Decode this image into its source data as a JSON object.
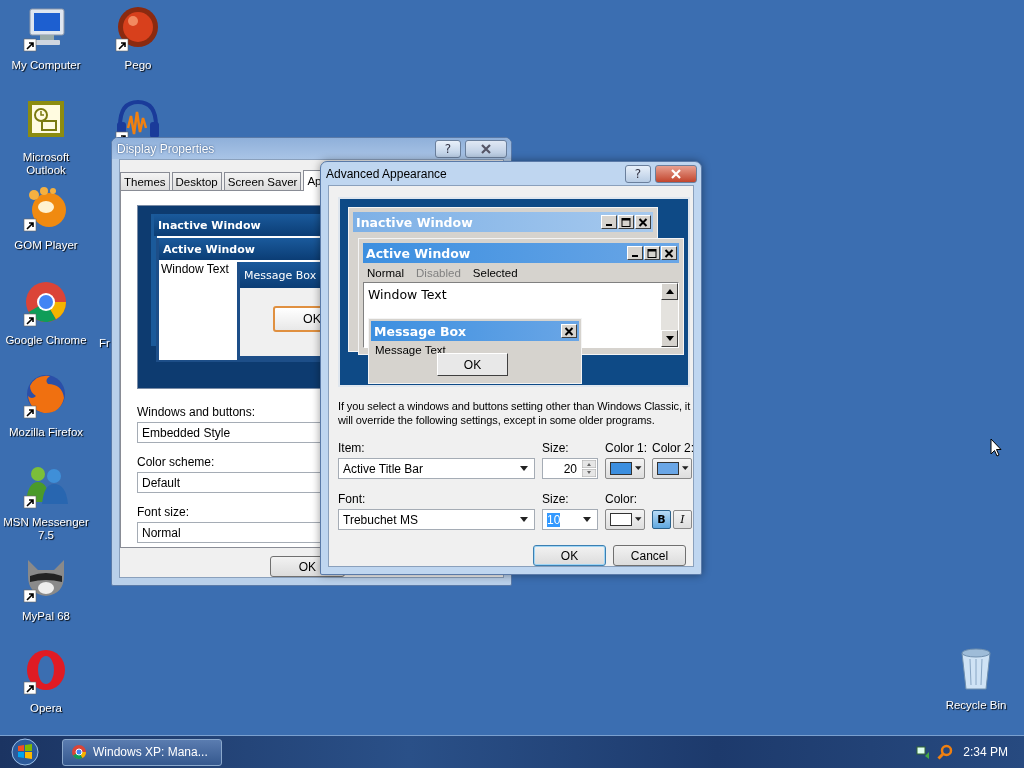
{
  "desktop_icons": [
    {
      "label": "My Computer",
      "kind": "computer"
    },
    {
      "label": "Pego",
      "kind": "ball"
    },
    {
      "label": "Microsoft\nOutlook",
      "kind": "outlook"
    },
    {
      "label": "GOM Player",
      "kind": "bubble"
    },
    {
      "label": "Google Chrome",
      "kind": "segments"
    },
    {
      "label": "Fr",
      "kind": "none"
    },
    {
      "label": "Mozilla Firefox",
      "kind": "globe"
    },
    {
      "label": "MSN Messenger\n7.5",
      "kind": "people"
    },
    {
      "label": "MyPal 68",
      "kind": "raccoon"
    },
    {
      "label": "Opera",
      "kind": "ring"
    },
    {
      "kind": "headphones"
    },
    {
      "label": "Recycle Bin",
      "kind": "bin"
    }
  ],
  "display_properties": {
    "title": "Display Properties",
    "help": "?",
    "tabs": [
      {
        "label": "Themes",
        "selected": false
      },
      {
        "label": "Desktop",
        "selected": false
      },
      {
        "label": "Screen Saver",
        "selected": false
      },
      {
        "label": "Ap",
        "selected": true
      }
    ],
    "preview": {
      "inactive_title": "Inactive Window",
      "active_title": "Active Window",
      "window_text": "Window Text",
      "message_title": "Message Box",
      "ok": "OK"
    },
    "fields": [
      {
        "label": "Windows and buttons:",
        "value": "Embedded Style"
      },
      {
        "label": "Color scheme:",
        "value": "Default"
      },
      {
        "label": "Font size:",
        "value": "Normal"
      }
    ],
    "ok": "OK"
  },
  "advanced_appearance": {
    "title": "Advanced Appearance",
    "help": "?",
    "preview": {
      "inactive_title": "Inactive Window",
      "active_title": "Active Window",
      "menu": [
        {
          "label": "Normal",
          "disabled": false
        },
        {
          "label": "Disabled",
          "disabled": true
        },
        {
          "label": "Selected",
          "disabled": false
        }
      ],
      "window_text": "Window Text",
      "message_title": "Message Box",
      "message_text": "Message Text",
      "ok": "OK"
    },
    "note": "If you select a windows and buttons setting other than Windows Classic, it will override the following settings, except in some older programs.",
    "item": {
      "label": "Item:",
      "value": "Active Title Bar"
    },
    "item_size": {
      "label": "Size:",
      "value": "20"
    },
    "color_1": {
      "label": "Color 1:",
      "color": "#3c8fe0"
    },
    "color_2": {
      "label": "Color 2:",
      "color": "#6aa6e6"
    },
    "font": {
      "label": "Font:",
      "value": "Trebuchet MS"
    },
    "font_size": {
      "label": "Size:",
      "value": "10",
      "highlighted": true
    },
    "font_color": {
      "label": "Color:",
      "color": "#ffffff"
    },
    "bold": {
      "label": "B",
      "selected": true
    },
    "italic": {
      "label": "I",
      "selected": false
    },
    "buttons": [
      "OK",
      "Cancel"
    ]
  },
  "taskbar": {
    "tasks": [
      {
        "label": "Windows XP: Mana...",
        "selected": false
      }
    ],
    "clock": "2:34 PM"
  }
}
